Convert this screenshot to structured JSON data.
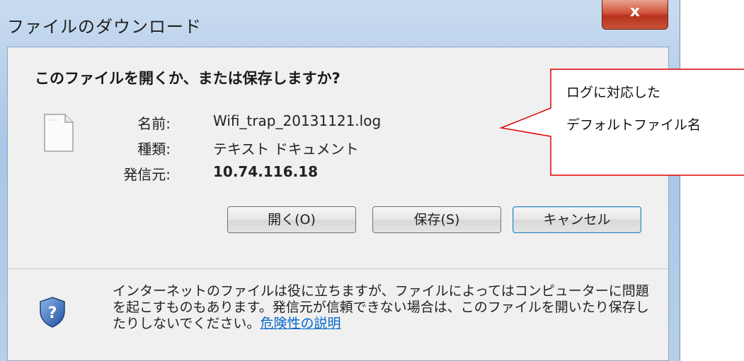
{
  "window": {
    "title": "ファイルのダウンロード",
    "close_label": "x"
  },
  "dialog": {
    "question": "このファイルを開くか、または保存しますか?",
    "fields": {
      "name_label": "名前:",
      "name_value": "Wifi_trap_20131121.log",
      "type_label": "種類:",
      "type_value": "テキスト ドキュメント",
      "from_label": "発信元:",
      "from_value": "10.74.116.18"
    },
    "buttons": {
      "open": "開く(O)",
      "save": "保存(S)",
      "cancel": "キャンセル"
    },
    "notice": {
      "text": "インターネットのファイルは役に立ちますが、ファイルによってはコンピューターに問題を起こすものもあります。発信元が信頼できない場合は、このファイルを開いたり保存したりしないでください。",
      "link": "危険性の説明"
    }
  },
  "callout": {
    "line1": "ログに対応した",
    "line2": "デフォルトファイル名"
  },
  "icons": {
    "file": "file-icon",
    "shield": "shield-help-icon"
  },
  "colors": {
    "close_button": "#c8533c",
    "callout_border": "#e00000",
    "link": "#0066cc"
  }
}
